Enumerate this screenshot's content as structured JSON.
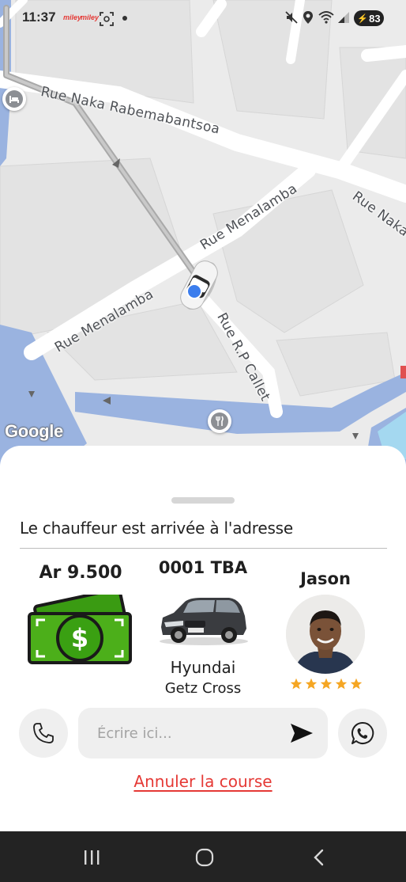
{
  "status_bar": {
    "time": "11:37",
    "notification_app_1": "miley",
    "notification_app_2": "miley",
    "battery": "83",
    "icons": [
      "mute-icon",
      "location-icon",
      "wifi-icon",
      "signal-icon",
      "battery-charging-icon"
    ]
  },
  "map": {
    "streets": {
      "naka_rabemabantsoa": "Rue Naka Rabemabantsoa",
      "naka_east": "Rue Naka",
      "menalamba_upper": "Rue Menalamba",
      "menalamba_lower": "Rue Menalamba",
      "rp_callet": "Rue R.P Callet"
    },
    "attribution": "Google",
    "pins": [
      "hotel-pin-icon",
      "restaurant-pin-icon"
    ]
  },
  "trip": {
    "status_message": "Le chauffeur est arrivée à l'adresse",
    "price": "Ar 9.500",
    "plate": "0001 TBA",
    "car_make": "Hyundai",
    "car_model": "Getz Cross",
    "driver_name": "Jason",
    "driver_rating": 5
  },
  "actions": {
    "message_placeholder": "Écrire ici...",
    "cancel_label": "Annuler la course"
  },
  "nav_bar": {
    "icons": [
      "recent-apps-icon",
      "home-icon",
      "back-icon"
    ]
  },
  "colors": {
    "accent_red": "#e53935",
    "rating_star": "#f5a623",
    "money_green": "#4caf1a",
    "route_grey": "#a9a9a9",
    "water_blue": "#9ab3e0"
  }
}
